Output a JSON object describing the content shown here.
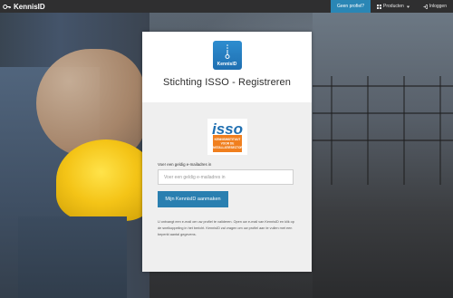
{
  "navbar": {
    "brand": "KennisID",
    "profile_button": "Geen profiel?",
    "products_menu": "Producten",
    "login_button": "Inloggen"
  },
  "card": {
    "logo_text": "KennisID",
    "title": "Stichting ISSO - Registreren",
    "partner_logo": {
      "name": "isso",
      "subtitle_lines": [
        "KENNISINSTITUUT",
        "VOOR DE",
        "INSTALLATIESECTOR"
      ]
    },
    "email_label": "Voer een geldig e-mailadres in",
    "email_placeholder": "Voer een geldig e-mailadres in",
    "email_value": "",
    "submit_label": "Mijn KennisID aanmaken",
    "info_text": "U ontvangt een e-mail om uw profiel te valideren. Open uw e-mail van KennisID en klik op de snelkoppeling in het bericht. KennisID zal vragen om uw profiel aan te vullen met een beperkt aantal gegevens."
  },
  "colors": {
    "accent": "#2a86b5",
    "button": "#2a7fb0",
    "isso_orange": "#f07f1e",
    "isso_blue": "#1f6fb1",
    "navbar": "#2f2f30"
  },
  "icons": {
    "brand": "key-icon",
    "products": "grid-icon",
    "products_caret": "caret-down-icon",
    "login": "sign-in-icon",
    "card_logo": "keyhole-icon"
  }
}
